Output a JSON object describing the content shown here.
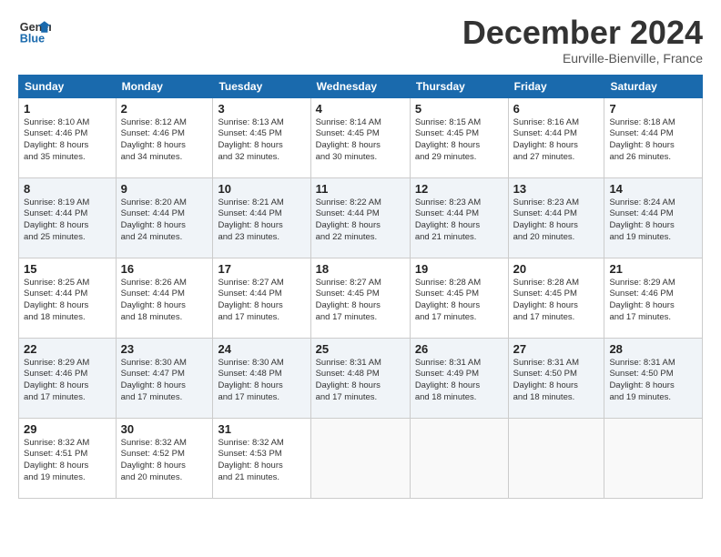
{
  "logo": {
    "line1": "General",
    "line2": "Blue"
  },
  "title": "December 2024",
  "location": "Eurville-Bienville, France",
  "days_header": [
    "Sunday",
    "Monday",
    "Tuesday",
    "Wednesday",
    "Thursday",
    "Friday",
    "Saturday"
  ],
  "weeks": [
    [
      {
        "day": "1",
        "info": "Sunrise: 8:10 AM\nSunset: 4:46 PM\nDaylight: 8 hours\nand 35 minutes."
      },
      {
        "day": "2",
        "info": "Sunrise: 8:12 AM\nSunset: 4:46 PM\nDaylight: 8 hours\nand 34 minutes."
      },
      {
        "day": "3",
        "info": "Sunrise: 8:13 AM\nSunset: 4:45 PM\nDaylight: 8 hours\nand 32 minutes."
      },
      {
        "day": "4",
        "info": "Sunrise: 8:14 AM\nSunset: 4:45 PM\nDaylight: 8 hours\nand 30 minutes."
      },
      {
        "day": "5",
        "info": "Sunrise: 8:15 AM\nSunset: 4:45 PM\nDaylight: 8 hours\nand 29 minutes."
      },
      {
        "day": "6",
        "info": "Sunrise: 8:16 AM\nSunset: 4:44 PM\nDaylight: 8 hours\nand 27 minutes."
      },
      {
        "day": "7",
        "info": "Sunrise: 8:18 AM\nSunset: 4:44 PM\nDaylight: 8 hours\nand 26 minutes."
      }
    ],
    [
      {
        "day": "8",
        "info": "Sunrise: 8:19 AM\nSunset: 4:44 PM\nDaylight: 8 hours\nand 25 minutes."
      },
      {
        "day": "9",
        "info": "Sunrise: 8:20 AM\nSunset: 4:44 PM\nDaylight: 8 hours\nand 24 minutes."
      },
      {
        "day": "10",
        "info": "Sunrise: 8:21 AM\nSunset: 4:44 PM\nDaylight: 8 hours\nand 23 minutes."
      },
      {
        "day": "11",
        "info": "Sunrise: 8:22 AM\nSunset: 4:44 PM\nDaylight: 8 hours\nand 22 minutes."
      },
      {
        "day": "12",
        "info": "Sunrise: 8:23 AM\nSunset: 4:44 PM\nDaylight: 8 hours\nand 21 minutes."
      },
      {
        "day": "13",
        "info": "Sunrise: 8:23 AM\nSunset: 4:44 PM\nDaylight: 8 hours\nand 20 minutes."
      },
      {
        "day": "14",
        "info": "Sunrise: 8:24 AM\nSunset: 4:44 PM\nDaylight: 8 hours\nand 19 minutes."
      }
    ],
    [
      {
        "day": "15",
        "info": "Sunrise: 8:25 AM\nSunset: 4:44 PM\nDaylight: 8 hours\nand 18 minutes."
      },
      {
        "day": "16",
        "info": "Sunrise: 8:26 AM\nSunset: 4:44 PM\nDaylight: 8 hours\nand 18 minutes."
      },
      {
        "day": "17",
        "info": "Sunrise: 8:27 AM\nSunset: 4:44 PM\nDaylight: 8 hours\nand 17 minutes."
      },
      {
        "day": "18",
        "info": "Sunrise: 8:27 AM\nSunset: 4:45 PM\nDaylight: 8 hours\nand 17 minutes."
      },
      {
        "day": "19",
        "info": "Sunrise: 8:28 AM\nSunset: 4:45 PM\nDaylight: 8 hours\nand 17 minutes."
      },
      {
        "day": "20",
        "info": "Sunrise: 8:28 AM\nSunset: 4:45 PM\nDaylight: 8 hours\nand 17 minutes."
      },
      {
        "day": "21",
        "info": "Sunrise: 8:29 AM\nSunset: 4:46 PM\nDaylight: 8 hours\nand 17 minutes."
      }
    ],
    [
      {
        "day": "22",
        "info": "Sunrise: 8:29 AM\nSunset: 4:46 PM\nDaylight: 8 hours\nand 17 minutes."
      },
      {
        "day": "23",
        "info": "Sunrise: 8:30 AM\nSunset: 4:47 PM\nDaylight: 8 hours\nand 17 minutes."
      },
      {
        "day": "24",
        "info": "Sunrise: 8:30 AM\nSunset: 4:48 PM\nDaylight: 8 hours\nand 17 minutes."
      },
      {
        "day": "25",
        "info": "Sunrise: 8:31 AM\nSunset: 4:48 PM\nDaylight: 8 hours\nand 17 minutes."
      },
      {
        "day": "26",
        "info": "Sunrise: 8:31 AM\nSunset: 4:49 PM\nDaylight: 8 hours\nand 18 minutes."
      },
      {
        "day": "27",
        "info": "Sunrise: 8:31 AM\nSunset: 4:50 PM\nDaylight: 8 hours\nand 18 minutes."
      },
      {
        "day": "28",
        "info": "Sunrise: 8:31 AM\nSunset: 4:50 PM\nDaylight: 8 hours\nand 19 minutes."
      }
    ],
    [
      {
        "day": "29",
        "info": "Sunrise: 8:32 AM\nSunset: 4:51 PM\nDaylight: 8 hours\nand 19 minutes."
      },
      {
        "day": "30",
        "info": "Sunrise: 8:32 AM\nSunset: 4:52 PM\nDaylight: 8 hours\nand 20 minutes."
      },
      {
        "day": "31",
        "info": "Sunrise: 8:32 AM\nSunset: 4:53 PM\nDaylight: 8 hours\nand 21 minutes."
      },
      null,
      null,
      null,
      null
    ]
  ]
}
